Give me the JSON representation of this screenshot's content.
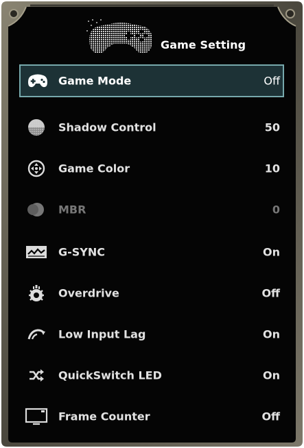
{
  "header": {
    "title": "Game Setting",
    "icon": "gamepad-icon"
  },
  "menu": {
    "items": [
      {
        "label": "Game Mode",
        "value": "Off",
        "icon": "gamepad-icon",
        "state": "selected"
      },
      {
        "label": "Shadow Control",
        "value": "50",
        "icon": "shadow-sphere-icon",
        "state": "normal"
      },
      {
        "label": "Game Color",
        "value": "10",
        "icon": "target-color-icon",
        "state": "normal"
      },
      {
        "label": "MBR",
        "value": "0",
        "icon": "blur-icon",
        "state": "disabled"
      },
      {
        "label": "G-SYNC",
        "value": "On",
        "icon": "gsync-icon",
        "state": "normal"
      },
      {
        "label": "Overdrive",
        "value": "Off",
        "icon": "overdrive-icon",
        "state": "normal"
      },
      {
        "label": "Low Input Lag",
        "value": "On",
        "icon": "speedometer-icon",
        "state": "normal"
      },
      {
        "label": "QuickSwitch LED",
        "value": "On",
        "icon": "shuffle-icon",
        "state": "normal"
      },
      {
        "label": "Frame Counter",
        "value": "Off",
        "icon": "monitor-icon",
        "state": "normal"
      }
    ]
  },
  "colors": {
    "background": "#050505",
    "frame": "#5e5a4c",
    "selected_fill": "#1d3236",
    "selected_border": "#77a9ac",
    "text": "#e2e2e2",
    "disabled_text": "#777777"
  }
}
